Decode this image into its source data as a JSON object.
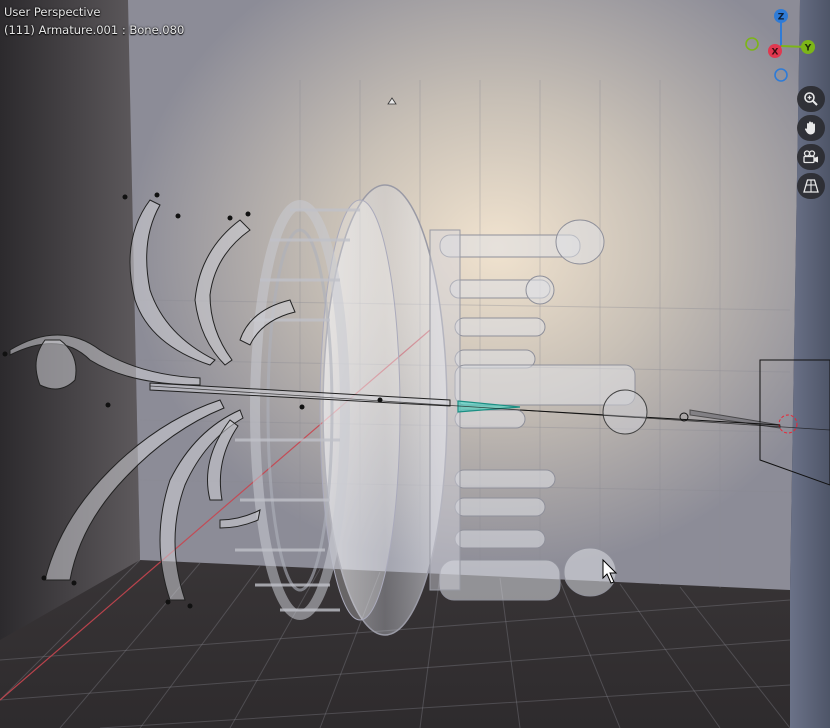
{
  "viewport": {
    "view_label": "User Perspective",
    "object_label": "(111) Armature.001 : Bone.080"
  },
  "gizmo": {
    "axes": [
      {
        "label": "Z",
        "color": "#2f7bd6"
      },
      {
        "label": "X",
        "color": "#e0384f"
      },
      {
        "label": "Y",
        "color": "#7cb518"
      }
    ]
  },
  "navigation": [
    {
      "name": "zoom-icon",
      "tooltip": "Zoom"
    },
    {
      "name": "pan-hand-icon",
      "tooltip": "Pan"
    },
    {
      "name": "camera-icon",
      "tooltip": "Camera view"
    },
    {
      "name": "grid-ortho-icon",
      "tooltip": "Orthographic/Perspective"
    }
  ],
  "colors": {
    "wall_back": "#d7cdbf",
    "wall_left": "#3a3538",
    "floor": "#4a4547",
    "x_axis_line": "#c8454f",
    "selection_cyan": "#38d6c4"
  }
}
